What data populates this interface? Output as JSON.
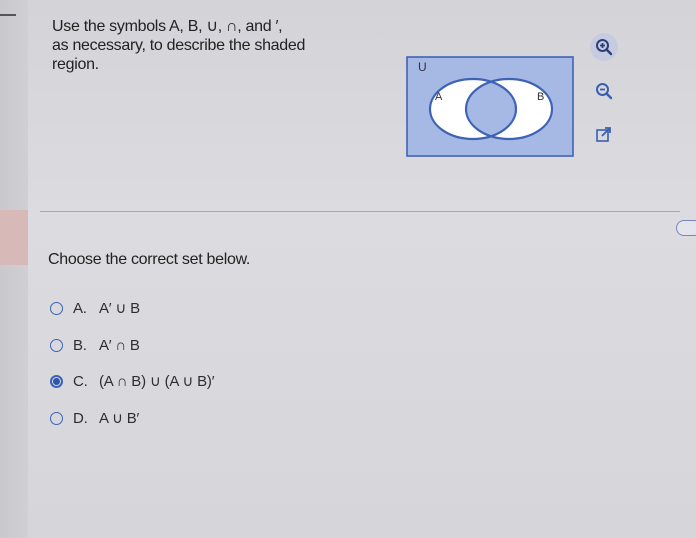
{
  "question": {
    "line1": "Use the symbols A, B, ∪, ∩, and ′,",
    "line2": "as necessary, to describe the shaded",
    "line3": "region."
  },
  "venn": {
    "universe_label": "U",
    "set_a_label": "A",
    "set_b_label": "B",
    "shaded": "intersection and complement of union",
    "shade_color": "#a6b8e4",
    "outline_color": "#3f63b4"
  },
  "tools": [
    {
      "icon": "zoom-in-icon"
    },
    {
      "icon": "zoom-out-icon"
    },
    {
      "icon": "external-link-icon"
    }
  ],
  "prompt": "Choose the correct set below.",
  "options": [
    {
      "letter": "A.",
      "text": "A′ ∪ B",
      "selected": false
    },
    {
      "letter": "B.",
      "text": "A′ ∩ B",
      "selected": false
    },
    {
      "letter": "C.",
      "text": "(A ∩ B) ∪ (A ∪ B)′",
      "selected": true
    },
    {
      "letter": "D.",
      "text": "A ∪ B′",
      "selected": false
    }
  ],
  "colors": {
    "accent": "#2b56b0",
    "background": "#d9d9dd"
  }
}
